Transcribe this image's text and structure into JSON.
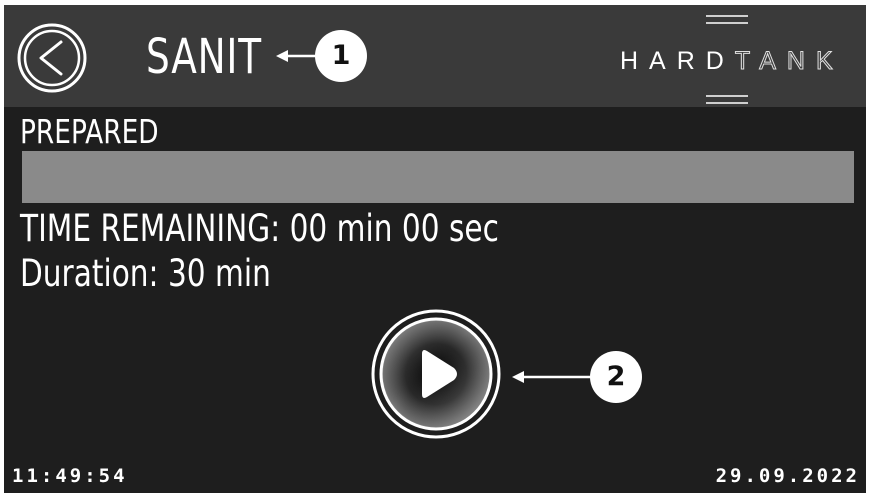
{
  "header": {
    "title": "SANIT",
    "logo": {
      "bold": "HARD",
      "light": "TANK"
    }
  },
  "main": {
    "status": "PREPARED",
    "progress": 1.0,
    "time_remaining": "TIME REMAINING: 00 min 00 sec",
    "duration": "Duration: 30 min"
  },
  "footer": {
    "time": "11:49:54",
    "date": "29.09.2022"
  },
  "callouts": [
    "1",
    "2"
  ],
  "icons": {
    "back": "back-arrow-icon",
    "play": "play-icon"
  },
  "colors": {
    "screen_bg": "#1e1e1e",
    "header_bg": "#3a3a3a",
    "progress_fill": "#8a8a8a",
    "text": "#ffffff"
  }
}
